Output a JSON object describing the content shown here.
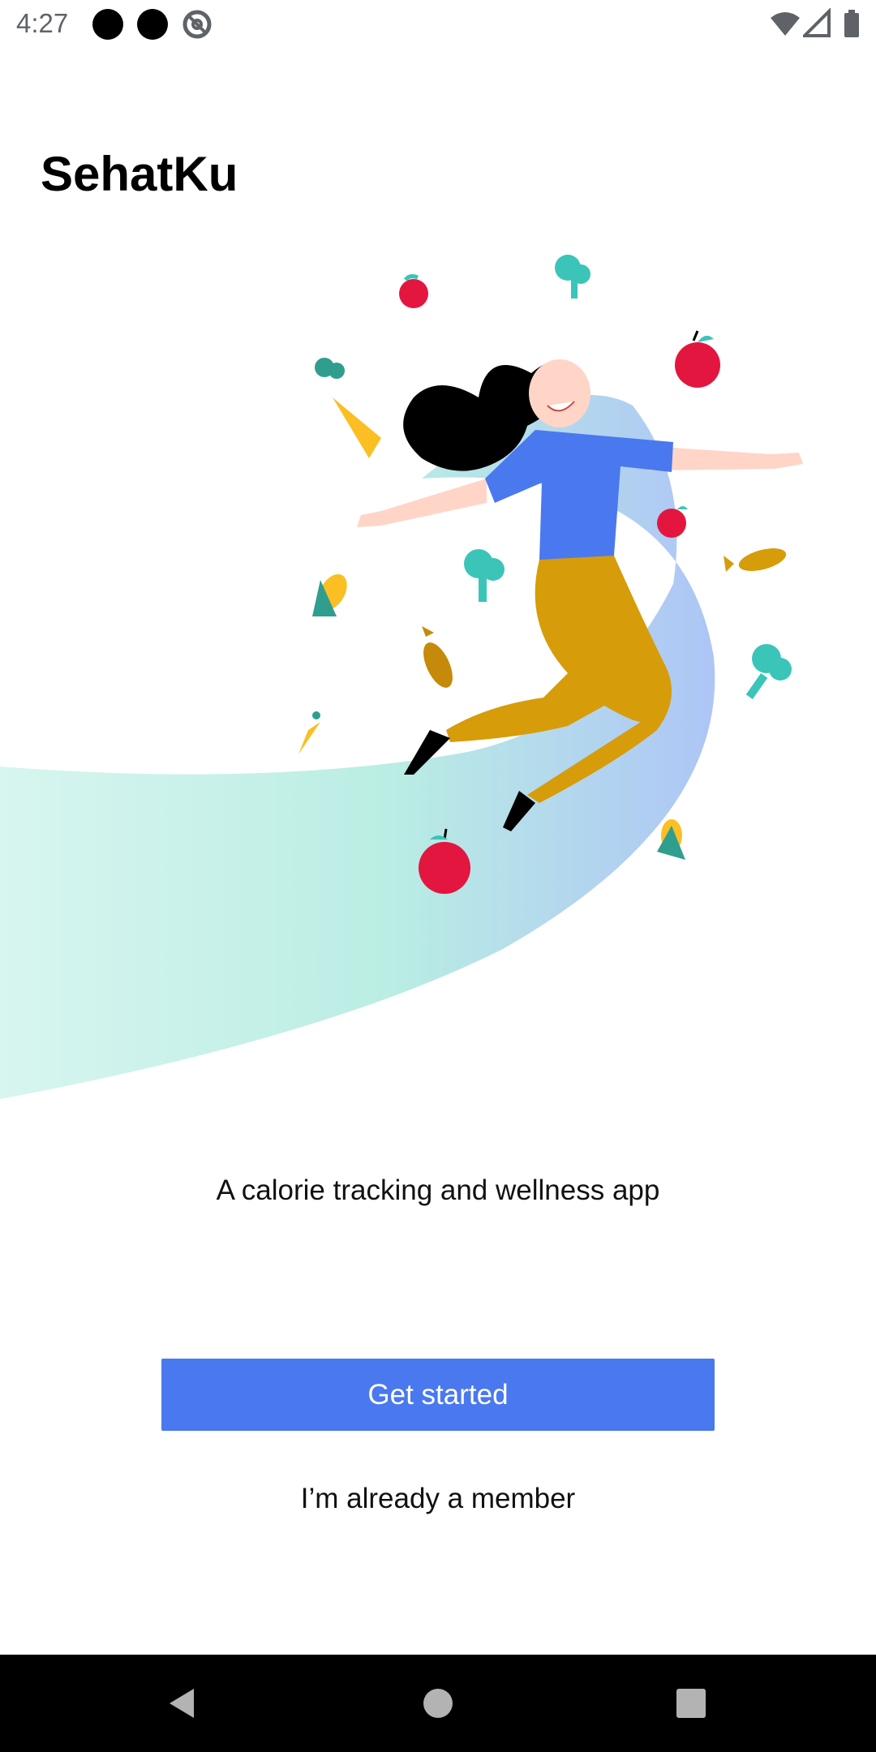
{
  "status_bar": {
    "time": "4:27",
    "icons": [
      "notification-dot-icon",
      "notification-dot-icon",
      "at-sign-icon",
      "wifi-icon",
      "cell-signal-icon",
      "battery-icon"
    ]
  },
  "app": {
    "title": "SehatKu"
  },
  "hero": {
    "illustration": "woman-jumping-with-fruits-and-vegetables"
  },
  "content": {
    "tagline": "A calorie tracking and wellness app"
  },
  "actions": {
    "get_started_label": "Get started",
    "member_label": "I’m already a member"
  },
  "navigation": {
    "buttons": [
      "back-icon",
      "home-icon",
      "recents-icon"
    ]
  },
  "colors": {
    "primary": "#4a78ee",
    "shirt": "#4a78ee",
    "pants": "#d69c0a",
    "apple": "#e3163f",
    "broccoli": "#3ac5b8",
    "swoosh_left": "#c5f0e8",
    "swoosh_right": "#a9c2f5"
  }
}
